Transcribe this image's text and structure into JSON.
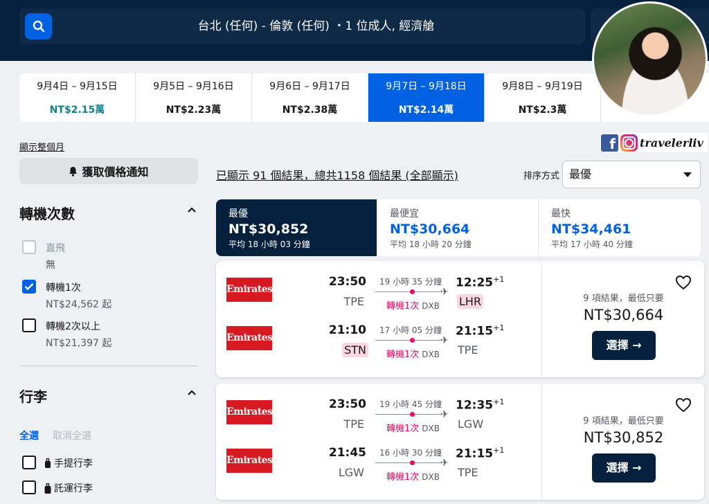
{
  "search": {
    "summary": "台北 (任何) - 倫敦 (任何) ・1 位成人, 經濟艙"
  },
  "dates": [
    {
      "label": "9月4日 – 9月15日",
      "price": "NT$2.15萬"
    },
    {
      "label": "9月5日 – 9月16日",
      "price": "NT$2.23萬"
    },
    {
      "label": "9月6日 – 9月17日",
      "price": "NT$2.38萬"
    },
    {
      "label": "9月7日 – 9月18日",
      "price": "NT$2.14萬"
    },
    {
      "label": "9月8日 – 9月19日",
      "price": "NT$2.3萬"
    }
  ],
  "social": {
    "handle": "travelerliv",
    "fb_glyph": "f"
  },
  "sidebar": {
    "show_month": "顯示整個月",
    "price_alert": "獲取價格通知",
    "stops_title": "轉機次數",
    "stops": [
      {
        "label": "直飛",
        "sub": "無",
        "checked": false,
        "disabled": true
      },
      {
        "label": "轉機1次",
        "sub": "NT$24,562 起",
        "checked": true,
        "disabled": false
      },
      {
        "label": "轉機2次以上",
        "sub": "NT$21,397 起",
        "checked": false,
        "disabled": false
      }
    ],
    "baggage_title": "行李",
    "select_all": "全選",
    "deselect_all": "取消全選",
    "baggage": [
      {
        "label": "手提行李"
      },
      {
        "label": "託運行李"
      }
    ]
  },
  "results": {
    "count_text": "已顯示 91 個結果，總共1158 個結果 (全部顯示)",
    "sort_label": "排序方式",
    "sort_value": "最優"
  },
  "sort_tabs": [
    {
      "title": "最優",
      "price": "NT$30,852",
      "duration": "平均 18 小時 03 分鐘"
    },
    {
      "title": "最便宜",
      "price": "NT$30,664",
      "duration": "平均 18 小時 20 分鐘"
    },
    {
      "title": "最快",
      "price": "NT$34,461",
      "duration": "平均 17 小時 40 分鐘"
    }
  ],
  "cards": [
    {
      "deals": "9 項結果，最低只要",
      "price": "NT$30,664",
      "select": "選擇 →",
      "legs": [
        {
          "airline": "Emirates",
          "dep_time": "23:50",
          "dep_code": "TPE",
          "duration": "19 小時 35 分鐘",
          "stops": "轉機1次",
          "via": "DXB",
          "arr_time": "12:25",
          "arr_plus": "+1",
          "arr_code": "LHR"
        },
        {
          "airline": "Emirates",
          "dep_time": "21:10",
          "dep_code": "STN",
          "duration": "17 小時 05 分鐘",
          "stops": "轉機1次",
          "via": "DXB",
          "arr_time": "21:15",
          "arr_plus": "+1",
          "arr_code": "TPE"
        }
      ]
    },
    {
      "deals": "9 項結果，最低只要",
      "price": "NT$30,852",
      "select": "選擇 →",
      "legs": [
        {
          "airline": "Emirates",
          "dep_time": "23:50",
          "dep_code": "TPE",
          "duration": "19 小時 45 分鐘",
          "stops": "轉機1次",
          "via": "DXB",
          "arr_time": "12:35",
          "arr_plus": "+1",
          "arr_code": "LGW"
        },
        {
          "airline": "Emirates",
          "dep_time": "21:45",
          "dep_code": "LGW",
          "duration": "16 小時 30 分鐘",
          "stops": "轉機1次",
          "via": "DXB",
          "arr_time": "21:15",
          "arr_plus": "+1",
          "arr_code": "TPE"
        }
      ]
    }
  ],
  "colors": {
    "navy": "#05203c",
    "blue": "#0062e3",
    "teal": "#0c838a",
    "pink": "#e70866",
    "emirates_red": "#d71921"
  }
}
